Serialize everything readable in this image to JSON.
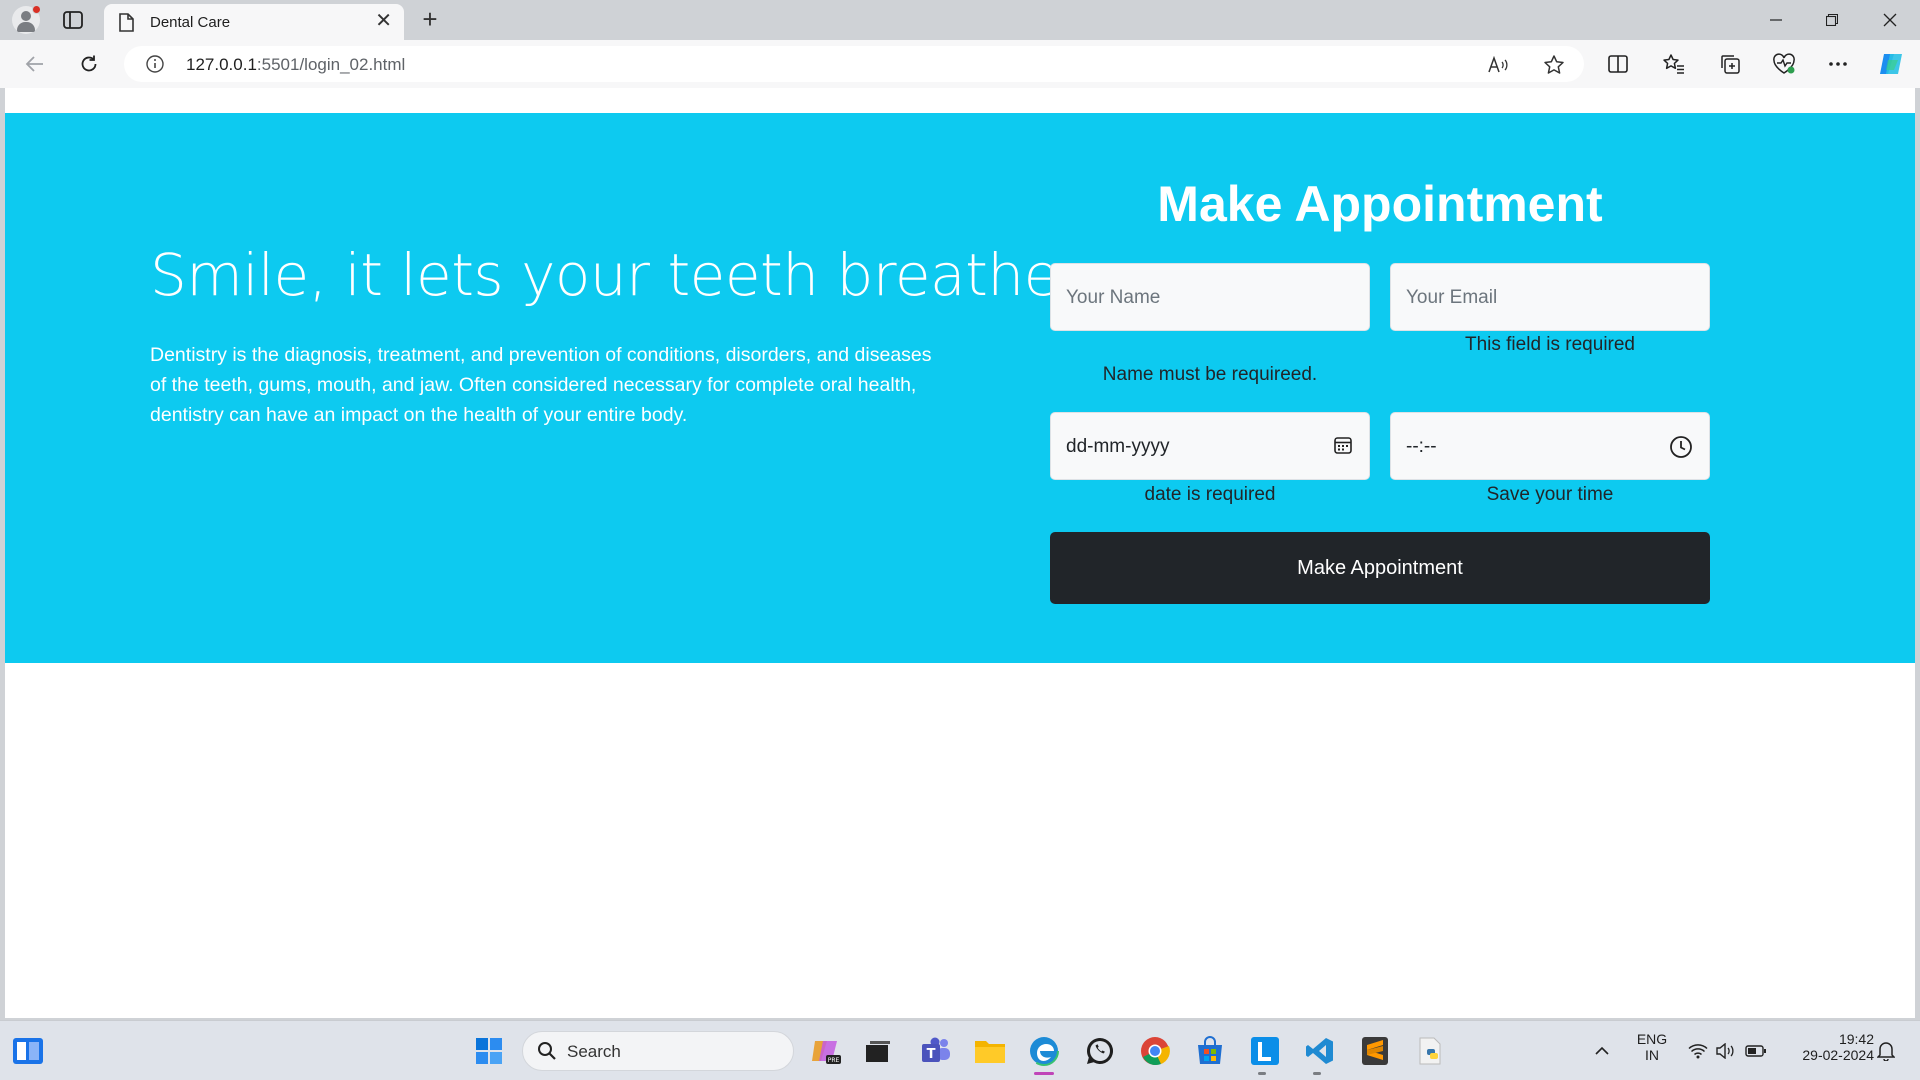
{
  "browser": {
    "tab_title": "Dental Care",
    "url_host": "127.0.0.1",
    "url_rest": ":5501/login_02.html"
  },
  "hero": {
    "heading": "Smile, it lets your teeth breathe",
    "description": "Dentistry is the diagnosis, treatment, and prevention of conditions, disorders, and diseases of the teeth, gums, mouth, and jaw. Often considered necessary for complete oral health, dentistry can have an impact on the health of your entire body."
  },
  "form": {
    "title": "Make Appointment",
    "name_placeholder": "Your Name",
    "email_placeholder": "Your Email",
    "email_message": "This field is required",
    "name_message": "Name must be requireed.",
    "date_value": "dd-mm-yyyy",
    "time_value": "--:--",
    "date_message": "date is required",
    "time_message": "Save your time",
    "submit_label": "Make Appointment"
  },
  "taskbar": {
    "search_label": "Search",
    "lang_line1": "ENG",
    "lang_line2": "IN",
    "time": "19:42",
    "date": "29-02-2024"
  },
  "colors": {
    "hero_bg": "#0dcaf0",
    "button_bg": "#212529",
    "page_bg": "#ffffff"
  }
}
